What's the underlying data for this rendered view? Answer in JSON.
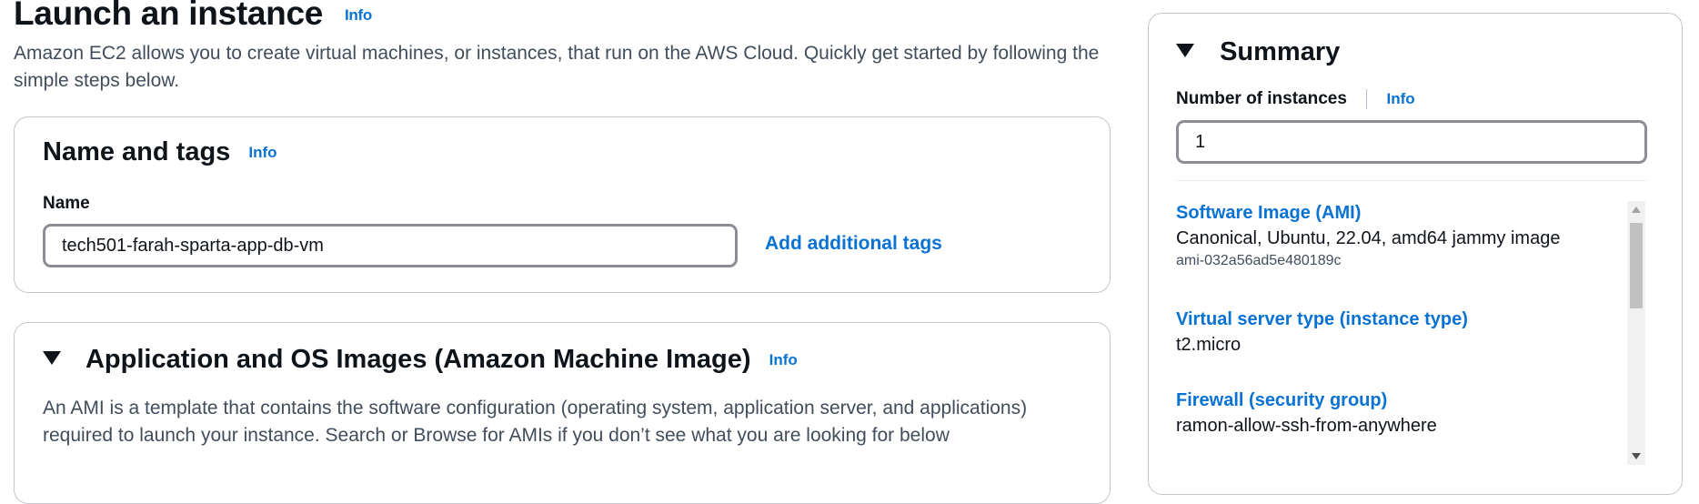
{
  "header": {
    "title": "Launch an instance",
    "info": "Info",
    "description": "Amazon EC2 allows you to create virtual machines, or instances, that run on the AWS Cloud. Quickly get started by following the simple steps below."
  },
  "name_and_tags": {
    "title": "Name and tags",
    "info": "Info",
    "name_label": "Name",
    "name_value": "tech501-farah-sparta-app-db-vm",
    "add_tags": "Add additional tags"
  },
  "ami_section": {
    "title": "Application and OS Images (Amazon Machine Image)",
    "info": "Info",
    "description": "An AMI is a template that contains the software configuration (operating system, application server, and applications) required to launch your instance. Search or Browse for AMIs if you don’t see what you are looking for below",
    "caret_icon": "caret-down-icon"
  },
  "summary": {
    "title": "Summary",
    "num_instances_label": "Number of instances",
    "info": "Info",
    "num_instances_value": "1",
    "items": [
      {
        "key": "Software Image (AMI)",
        "value": "Canonical, Ubuntu, 22.04, amd64 jammy image",
        "sub": "ami-032a56ad5e480189c"
      },
      {
        "key": "Virtual server type (instance type)",
        "value": "t2.micro"
      },
      {
        "key": "Firewall (security group)",
        "value": "ramon-allow-ssh-from-anywhere"
      }
    ]
  },
  "colors": {
    "link": "#0972d3",
    "text": "#0f141a",
    "border": "#c6c6cd"
  }
}
